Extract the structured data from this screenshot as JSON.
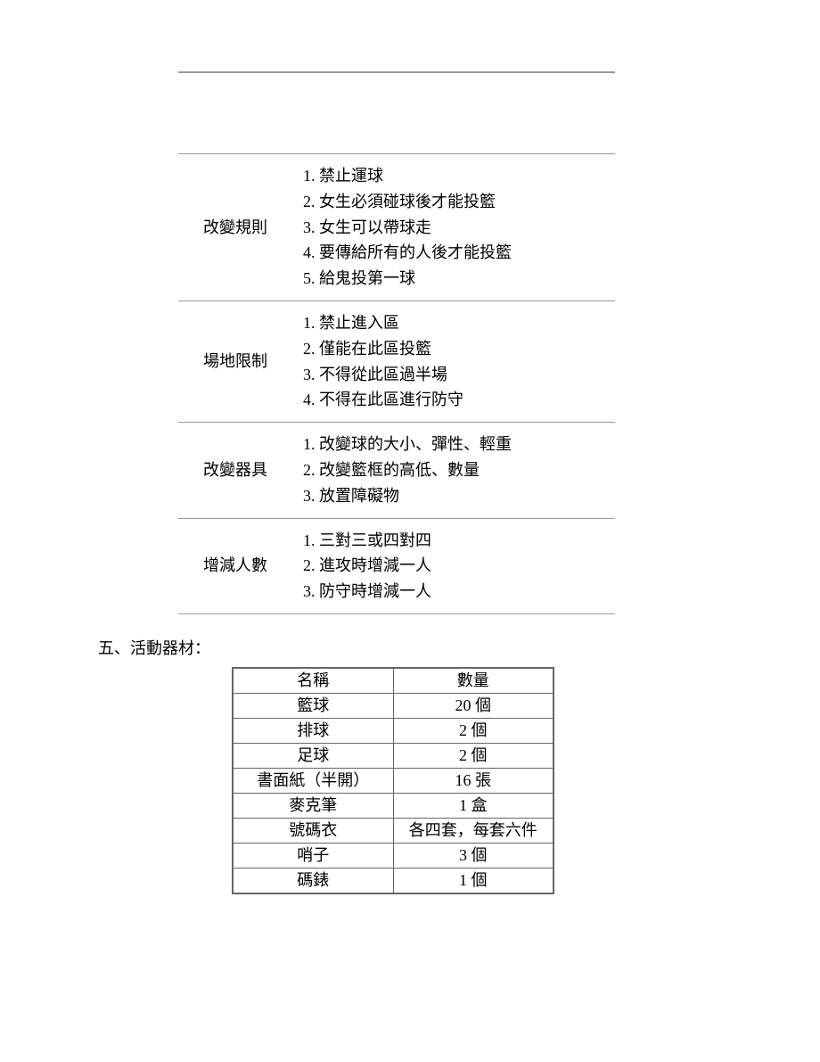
{
  "sections": [
    {
      "label": "",
      "items": []
    },
    {
      "label": "",
      "items": [],
      "spacer": true
    },
    {
      "label": "改變規則",
      "items": [
        "1. 禁止運球",
        "2. 女生必須碰球後才能投籃",
        "3. 女生可以帶球走",
        "4. 要傳給所有的人後才能投籃",
        "5. 給鬼投第一球"
      ]
    },
    {
      "label": "場地限制",
      "items": [
        "1. 禁止進入區",
        "2. 僅能在此區投籃",
        "3. 不得從此區過半場",
        "4. 不得在此區進行防守"
      ]
    },
    {
      "label": "改變器具",
      "items": [
        "1. 改變球的大小、彈性、輕重",
        "2. 改變籃框的高低、數量",
        "3. 放置障礙物"
      ]
    },
    {
      "label": "增減人數",
      "items": [
        "1. 三對三或四對四",
        "2. 進攻時增減一人",
        "3. 防守時增減一人"
      ]
    }
  ],
  "heading": "五、活動器材：",
  "equipment": {
    "headers": [
      "名稱",
      "數量"
    ],
    "rows": [
      [
        "籃球",
        "20 個"
      ],
      [
        "排球",
        "2 個"
      ],
      [
        "足球",
        "2 個"
      ],
      [
        "書面紙（半開）",
        "16 張"
      ],
      [
        "麥克筆",
        "1 盒"
      ],
      [
        "號碼衣",
        "各四套，每套六件"
      ],
      [
        "哨子",
        "3 個"
      ],
      [
        "碼錶",
        "1 個"
      ]
    ]
  }
}
